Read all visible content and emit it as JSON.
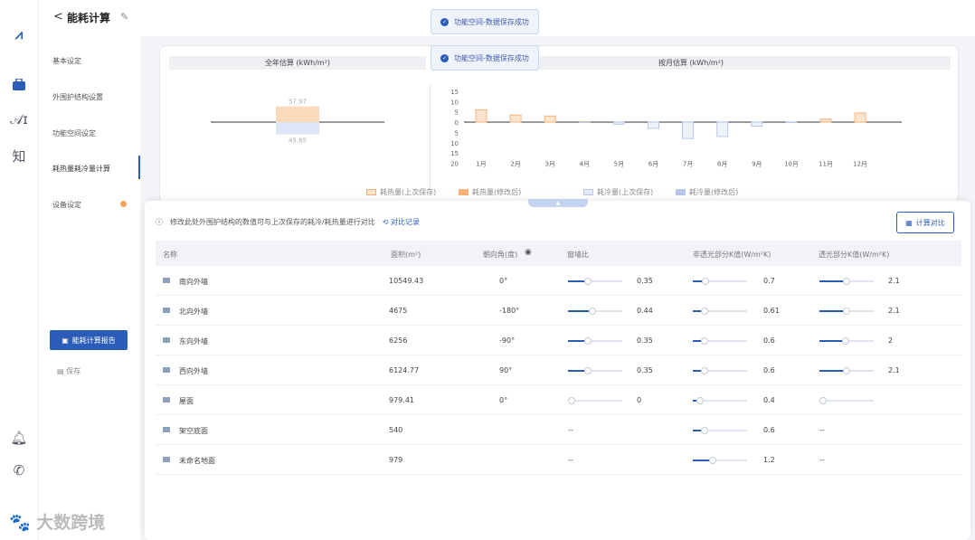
{
  "header": {
    "back": "<",
    "title": "能耗计算",
    "edit_icon": "edit-icon"
  },
  "toasts": [
    "功能空间-数据保存成功",
    "功能空间-数据保存成功"
  ],
  "sidemenu": {
    "items": [
      "基本设定",
      "外围护结构设置",
      "功能空间设定",
      "耗热量耗冷量计算",
      "设备设定"
    ],
    "report_btn": "能耗计算报告",
    "save_btn": "保存"
  },
  "chart_data": [
    {
      "type": "bar",
      "title": "全年估算 (kWh/m²)",
      "series": [
        {
          "values": [
            57.97
          ]
        },
        {
          "values": [
            -45.65
          ]
        }
      ],
      "labels": [
        "57.97",
        "45.65"
      ]
    },
    {
      "type": "bar",
      "title": "按月估算 (kWh/m²)",
      "categories": [
        "1月",
        "2月",
        "3月",
        "4月",
        "5月",
        "6月",
        "7月",
        "8月",
        "9月",
        "10月",
        "11月",
        "12月"
      ],
      "yticks": [
        "15",
        "10",
        "5",
        "0",
        "5",
        "10",
        "15",
        "20"
      ],
      "ylim": [
        -20,
        15
      ],
      "series": [
        {
          "name": "耗热量(上次保存)",
          "values": [
            6,
            3.5,
            3,
            0.3,
            0,
            0,
            0,
            0,
            0,
            0,
            1.5,
            4.5
          ]
        },
        {
          "name": "耗热量(修改后)",
          "values": [
            6,
            3.5,
            3,
            0.3,
            0,
            0,
            0,
            0,
            0,
            0,
            1.5,
            4.5
          ]
        },
        {
          "name": "耗冷量(上次保存)",
          "values": [
            0,
            0,
            0,
            -0.2,
            -1,
            -3,
            -8,
            -7,
            -2,
            -0.2,
            0,
            0
          ]
        },
        {
          "name": "耗冷量(修改后)",
          "values": [
            0,
            0,
            0,
            -0.2,
            -1,
            -3,
            -8,
            -7,
            -2,
            -0.2,
            0,
            0
          ]
        }
      ],
      "legend_position": "bottom",
      "colors": {
        "heat_prev": "#fbe4cf",
        "heat_new": "#f5b27a",
        "cold_prev": "#e6ebf5",
        "cold_new": "#b7c8ea"
      }
    }
  ],
  "legend": [
    "耗热量(上次保存)",
    "耗热量(修改后)",
    "耗冷量(上次保存)",
    "耗冷量(修改后)"
  ],
  "info": {
    "text": "修改此处外围护结构的数值可与上次保存的耗冷/耗热量进行对比",
    "link": "对比记录"
  },
  "calc_btn": "计算对比",
  "table": {
    "headers": [
      "名称",
      "面积(m²)",
      "朝向角(度)",
      "窗墙比",
      "非透光部分K值(W/m²K)",
      "透光部分K值(W/m²K)"
    ],
    "rows": [
      {
        "name": "南向外墙",
        "area": "10549.43",
        "angle": "0°",
        "ratio": "0.35",
        "ratio_pos": 0.35,
        "k1": "0.7",
        "k1_pos": 0.2,
        "k2": "2.1",
        "k2_pos": 0.5
      },
      {
        "name": "北向外墙",
        "area": "4675",
        "angle": "-180°",
        "ratio": "0.44",
        "ratio_pos": 0.44,
        "k1": "0.61",
        "k1_pos": 0.17,
        "k2": "2.1",
        "k2_pos": 0.5
      },
      {
        "name": "东向外墙",
        "area": "6256",
        "angle": "-90°",
        "ratio": "0.35",
        "ratio_pos": 0.35,
        "k1": "0.6",
        "k1_pos": 0.17,
        "k2": "2",
        "k2_pos": 0.48
      },
      {
        "name": "西向外墙",
        "area": "6124.77",
        "angle": "90°",
        "ratio": "0.35",
        "ratio_pos": 0.35,
        "k1": "0.6",
        "k1_pos": 0.17,
        "k2": "2.1",
        "k2_pos": 0.5
      },
      {
        "name": "屋面",
        "area": "979.41",
        "angle": "0°",
        "ratio": "0",
        "ratio_pos": 0,
        "k1": "0.4",
        "k1_pos": 0.08,
        "k2": "",
        "k2_pos": 0
      },
      {
        "name": "架空底面",
        "area": "540",
        "angle": "",
        "ratio": "--",
        "ratio_pos": -1,
        "k1": "0.6",
        "k1_pos": 0.17,
        "k2": "--",
        "k2_pos": -1
      },
      {
        "name": "未命名地面",
        "area": "979",
        "angle": "",
        "ratio": "--",
        "ratio_pos": -1,
        "k1": "1.2",
        "k1_pos": 0.35,
        "k2": "--",
        "k2_pos": -1
      }
    ]
  },
  "watermark": "大数跨境"
}
